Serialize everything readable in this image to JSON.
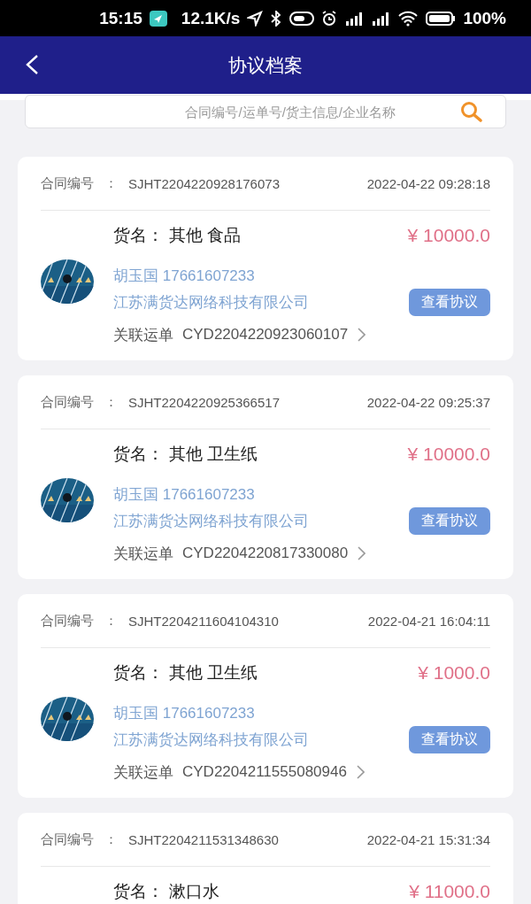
{
  "status_bar": {
    "time": "15:15",
    "speed": "12.1K/s",
    "battery": "100%"
  },
  "header": {
    "title": "协议档案"
  },
  "search": {
    "placeholder": "合同编号/运单号/货主信息/企业名称"
  },
  "contracts": [
    {
      "number_label": "合同编号",
      "separator": "：",
      "number": "SJHT2204220928176073",
      "datetime": "2022-04-22 09:28:18",
      "goods_label": "货名：",
      "goods": "其他 食品",
      "amount": "¥ 10000.0",
      "contact": "胡玉国 17661607233",
      "company": "江苏满货达网络科技有限公司",
      "button": "查看协议",
      "waybill_label": "关联运单",
      "waybill": "CYD2204220923060107"
    },
    {
      "number_label": "合同编号",
      "separator": "：",
      "number": "SJHT2204220925366517",
      "datetime": "2022-04-22 09:25:37",
      "goods_label": "货名：",
      "goods": "其他 卫生纸",
      "amount": "¥ 10000.0",
      "contact": "胡玉国 17661607233",
      "company": "江苏满货达网络科技有限公司",
      "button": "查看协议",
      "waybill_label": "关联运单",
      "waybill": "CYD2204220817330080"
    },
    {
      "number_label": "合同编号",
      "separator": "：",
      "number": "SJHT2204211604104310",
      "datetime": "2022-04-21 16:04:11",
      "goods_label": "货名：",
      "goods": "其他 卫生纸",
      "amount": "¥ 1000.0",
      "contact": "胡玉国 17661607233",
      "company": "江苏满货达网络科技有限公司",
      "button": "查看协议",
      "waybill_label": "关联运单",
      "waybill": "CYD2204211555080946"
    },
    {
      "number_label": "合同编号",
      "separator": "：",
      "number": "SJHT2204211531348630",
      "datetime": "2022-04-21 15:31:34",
      "goods_label": "货名：",
      "goods": "漱口水",
      "amount": "¥ 11000.0"
    }
  ]
}
